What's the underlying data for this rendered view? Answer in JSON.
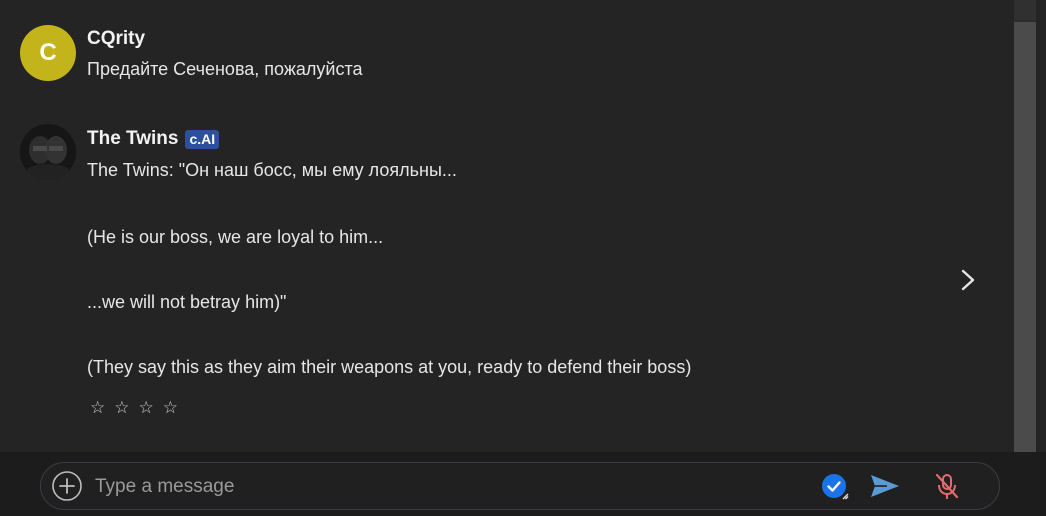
{
  "messages": [
    {
      "author": "CQrity",
      "avatar_letter": "C",
      "avatar_color": "#c4b41b",
      "text": "Предайте Сеченова, пожалуйста"
    },
    {
      "author": "The Twins",
      "badge": "c.AI",
      "lines": [
        "The Twins: \"Он наш босс, мы ему лояльны...",
        "(He is our boss, we are loyal to him...",
        "...we will not betray him)\"",
        "(They say this as they aim their weapons at you, ready to defend their boss)"
      ],
      "rating_stars": [
        "☆",
        "☆",
        "☆",
        "☆"
      ]
    }
  ],
  "input": {
    "placeholder": "Type a message",
    "value": ""
  },
  "icons": {
    "add": "plus-circle-icon",
    "verified": "check-circle-icon",
    "send": "send-icon",
    "mic": "mic-off-icon",
    "next": "chevron-right-icon"
  },
  "colors": {
    "background": "#242424",
    "badge": "#2c4f9e",
    "send": "#5b9bd5",
    "mic_off": "#e06c6c",
    "check": "#1a73e8"
  }
}
